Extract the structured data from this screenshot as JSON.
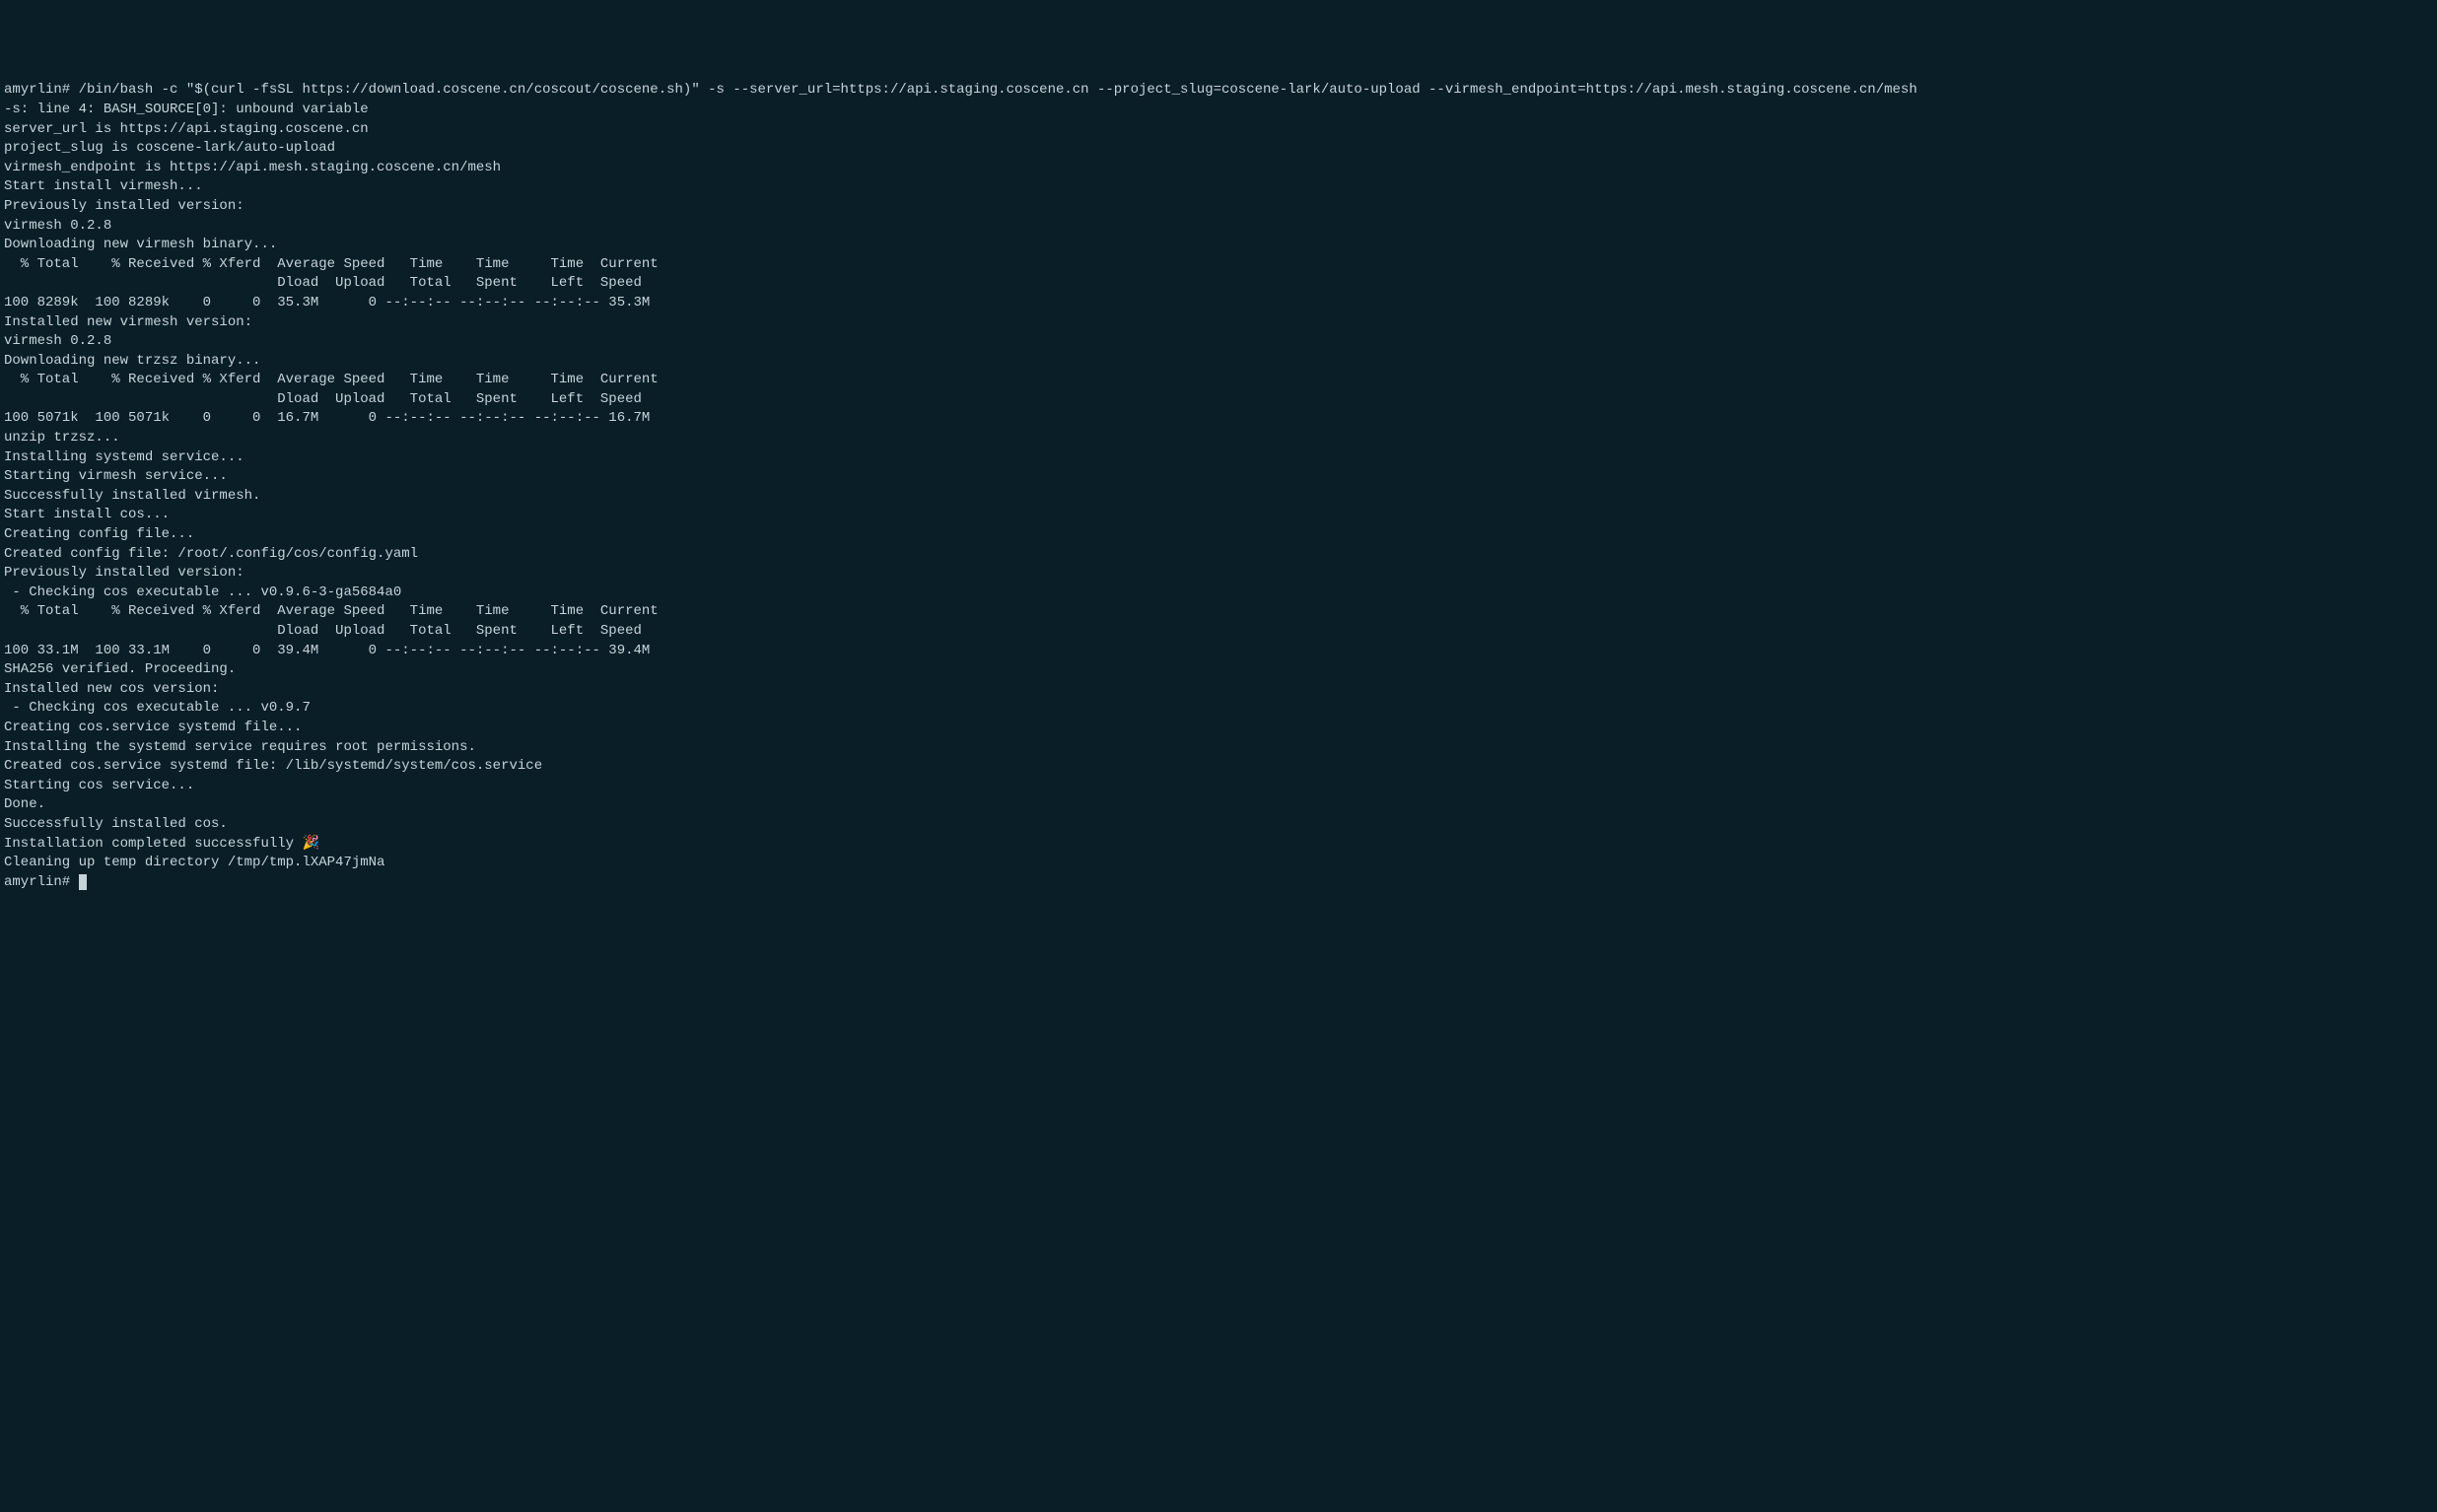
{
  "terminal": {
    "lines": [
      "amyrlin# /bin/bash -c \"$(curl -fsSL https://download.coscene.cn/coscout/coscene.sh)\" -s --server_url=https://api.staging.coscene.cn --project_slug=coscene-lark/auto-upload --virmesh_endpoint=https://api.mesh.staging.coscene.cn/mesh",
      "-s: line 4: BASH_SOURCE[0]: unbound variable",
      "server_url is https://api.staging.coscene.cn",
      "project_slug is coscene-lark/auto-upload",
      "virmesh_endpoint is https://api.mesh.staging.coscene.cn/mesh",
      "Start install virmesh...",
      "Previously installed version:",
      "virmesh 0.2.8",
      "Downloading new virmesh binary...",
      "  % Total    % Received % Xferd  Average Speed   Time    Time     Time  Current",
      "                                 Dload  Upload   Total   Spent    Left  Speed",
      "100 8289k  100 8289k    0     0  35.3M      0 --:--:-- --:--:-- --:--:-- 35.3M",
      "Installed new virmesh version:",
      "virmesh 0.2.8",
      "Downloading new trzsz binary...",
      "  % Total    % Received % Xferd  Average Speed   Time    Time     Time  Current",
      "                                 Dload  Upload   Total   Spent    Left  Speed",
      "100 5071k  100 5071k    0     0  16.7M      0 --:--:-- --:--:-- --:--:-- 16.7M",
      "unzip trzsz...",
      "Installing systemd service...",
      "Starting virmesh service...",
      "Successfully installed virmesh.",
      "Start install cos...",
      "Creating config file...",
      "Created config file: /root/.config/cos/config.yaml",
      "Previously installed version:",
      " - Checking cos executable ... v0.9.6-3-ga5684a0",
      "  % Total    % Received % Xferd  Average Speed   Time    Time     Time  Current",
      "                                 Dload  Upload   Total   Spent    Left  Speed",
      "100 33.1M  100 33.1M    0     0  39.4M      0 --:--:-- --:--:-- --:--:-- 39.4M",
      "SHA256 verified. Proceeding.",
      "Installed new cos version:",
      " - Checking cos executable ... v0.9.7",
      "Creating cos.service systemd file...",
      "Installing the systemd service requires root permissions.",
      "Created cos.service systemd file: /lib/systemd/system/cos.service",
      "Starting cos service...",
      "Done.",
      "Successfully installed cos.",
      "Installation completed successfully 🎉",
      "Cleaning up temp directory /tmp/tmp.lXAP47jmNa"
    ],
    "prompt": "amyrlin# "
  }
}
